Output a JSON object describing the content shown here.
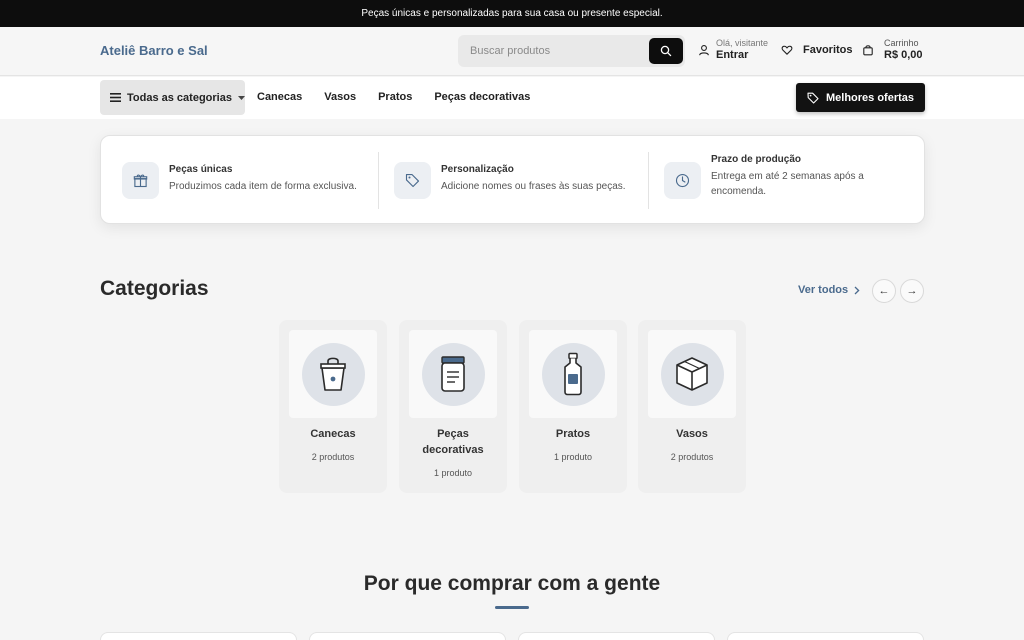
{
  "topbar": {
    "text": "Peças únicas e personalizadas para sua casa ou presente especial."
  },
  "header": {
    "logo": "Ateliê Barro e Sal",
    "search_placeholder": "Buscar produtos",
    "account_greeting": "Olá, visitante",
    "account_action": "Entrar",
    "favorites": "Favoritos",
    "cart_label": "Carrinho",
    "cart_total": "R$ 0,00"
  },
  "nav": {
    "all_categories": "Todas as categorias",
    "links": [
      "Canecas",
      "Vasos",
      "Pratos",
      "Peças decorativas"
    ],
    "deals": "Melhores ofertas"
  },
  "features": [
    {
      "icon": "gift-icon",
      "title": "Peças únicas",
      "desc": "Produzimos cada item de forma exclusiva."
    },
    {
      "icon": "tag-icon",
      "title": "Personalização",
      "desc": "Adicione nomes ou frases às suas peças."
    },
    {
      "icon": "clock-icon",
      "title": "Prazo de produção",
      "desc": "Entrega em até 2 semanas após a encomenda."
    }
  ],
  "categories_section": {
    "title": "Categorias",
    "see_all": "Ver todos",
    "prev": "←",
    "next": "→",
    "items": [
      {
        "icon": "mug-icon",
        "name": "Canecas",
        "count": "2 produtos"
      },
      {
        "icon": "jar-icon",
        "name": "Peças decorativas",
        "count": "1 produto"
      },
      {
        "icon": "bottle-icon",
        "name": "Pratos",
        "count": "1 produto"
      },
      {
        "icon": "box-icon",
        "name": "Vasos",
        "count": "2 produtos"
      }
    ]
  },
  "why_section": {
    "title": "Por que comprar com a gente"
  },
  "colors": {
    "accent": "#4a6a8d",
    "dark": "#0d0d0d",
    "background": "#f5f5f5"
  }
}
